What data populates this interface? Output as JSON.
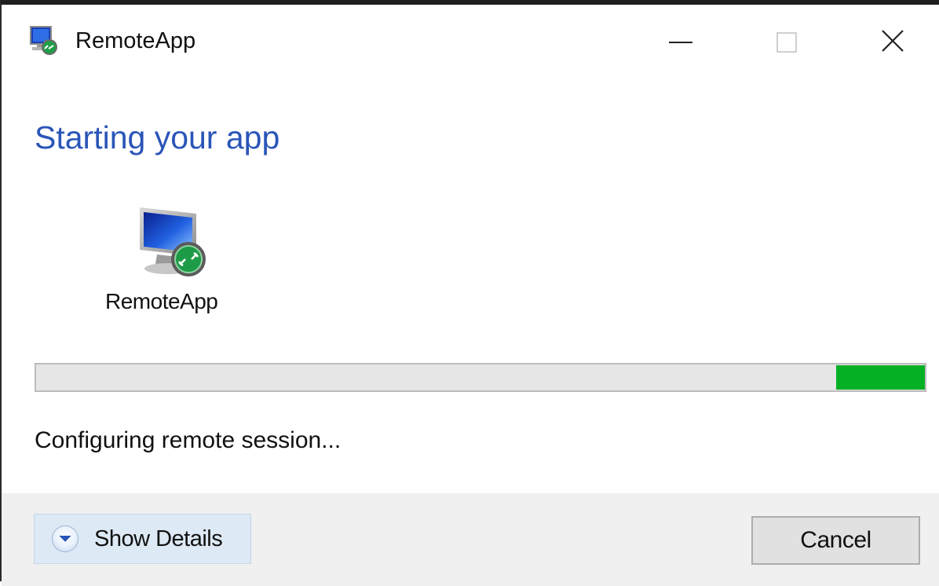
{
  "window": {
    "title": "RemoteApp",
    "icon": "remoteapp-icon",
    "controls": {
      "minimize_icon": "minimize-icon",
      "maximize_icon": "maximize-icon",
      "close_icon": "close-icon"
    }
  },
  "main": {
    "heading": "Starting your app",
    "app": {
      "label": "RemoteApp",
      "icon": "remote-desktop-monitor-icon"
    },
    "progress": {
      "value": 0.1,
      "color": "#06b025"
    },
    "status": "Configuring remote session..."
  },
  "footer": {
    "details_label": "Show Details",
    "details_icon": "chevron-down-icon",
    "cancel_label": "Cancel"
  },
  "colors": {
    "heading": "#2a55b8",
    "footer_bg": "#f0f0f0",
    "details_bg": "#dde9f5"
  }
}
